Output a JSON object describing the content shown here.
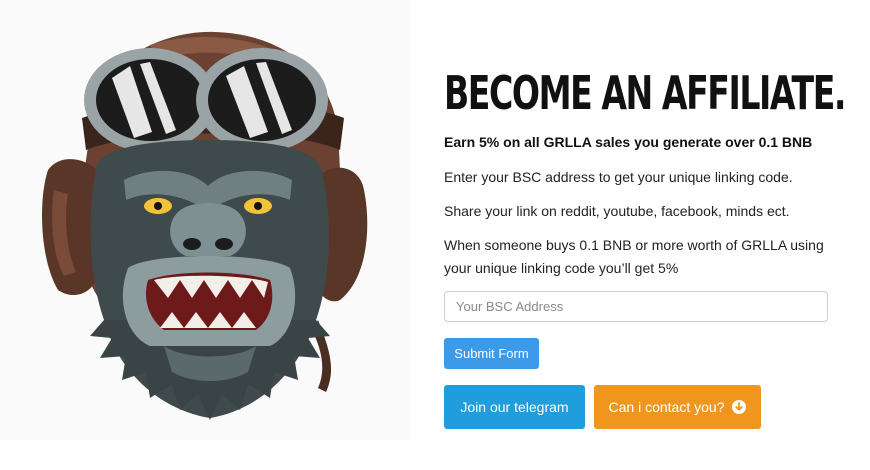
{
  "illustration": {
    "name": "gorilla-aviator-illustration"
  },
  "affiliate": {
    "headline": "BECOME AN AFFILIATE.",
    "lead": "Earn 5% on all GRLLA sales you generate over 0.1 BNB",
    "paragraphs": [
      "Enter your BSC address to get your unique linking code.",
      "Share your link on reddit, youtube, facebook, minds ect.",
      "When someone buys 0.1 BNB or more worth of GRLLA using your unique linking code you’ll get 5%"
    ]
  },
  "form": {
    "address_placeholder": "Your BSC Address",
    "address_value": "",
    "submit_label": "Submit Form"
  },
  "actions": {
    "telegram_label": "Join our telegram",
    "contact_label": "Can i contact you?",
    "contact_icon": "arrow-circle-down-icon"
  },
  "colors": {
    "submit": "#3d9ae8",
    "telegram": "#1f9ddd",
    "contact": "#f0961f"
  }
}
